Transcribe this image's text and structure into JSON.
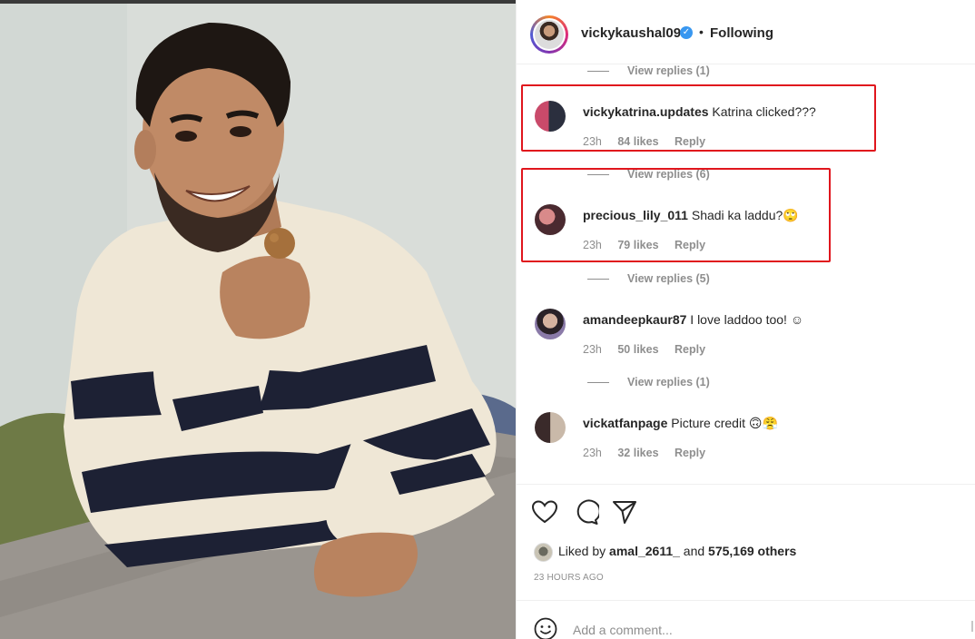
{
  "post": {
    "username": "vickykaushal09",
    "separator": "•",
    "follow_state": "Following",
    "verified_glyph": "✓"
  },
  "comments": [
    {
      "replies_label": "View replies (1)"
    },
    {
      "user": "vickykatrina.updates",
      "text": "Katrina clicked???",
      "time": "23h",
      "likes": "84 likes",
      "reply": "Reply",
      "highlighted": true
    },
    {
      "replies_label": "View replies (6)"
    },
    {
      "user": "precious_lily_011",
      "text": "Shadi ka laddu?🙄",
      "time": "23h",
      "likes": "79 likes",
      "reply": "Reply",
      "highlighted": true
    },
    {
      "replies_label": "View replies (5)"
    },
    {
      "user": "amandeepkaur87",
      "text": "I love laddoo too! ☺",
      "time": "23h",
      "likes": "50 likes",
      "reply": "Reply"
    },
    {
      "replies_label": "View replies (1)"
    },
    {
      "user": "vickatfanpage",
      "text": "Picture credit 🙃😤",
      "time": "23h",
      "likes": "32 likes",
      "reply": "Reply"
    }
  ],
  "likes": {
    "prefix": "Liked by",
    "user": "amal_2611_",
    "middle": "and",
    "others": "575,169 others"
  },
  "timestamp": "23 HOURS AGO",
  "add_comment": {
    "placeholder": "Add a comment..."
  },
  "icons": [
    "heart-icon",
    "comment-icon",
    "share-icon",
    "emoji-icon",
    "verified-icon"
  ],
  "colors": {
    "highlight_box": "#e0161d",
    "verified": "#3897f0",
    "muted_text": "#8e8e8e"
  }
}
